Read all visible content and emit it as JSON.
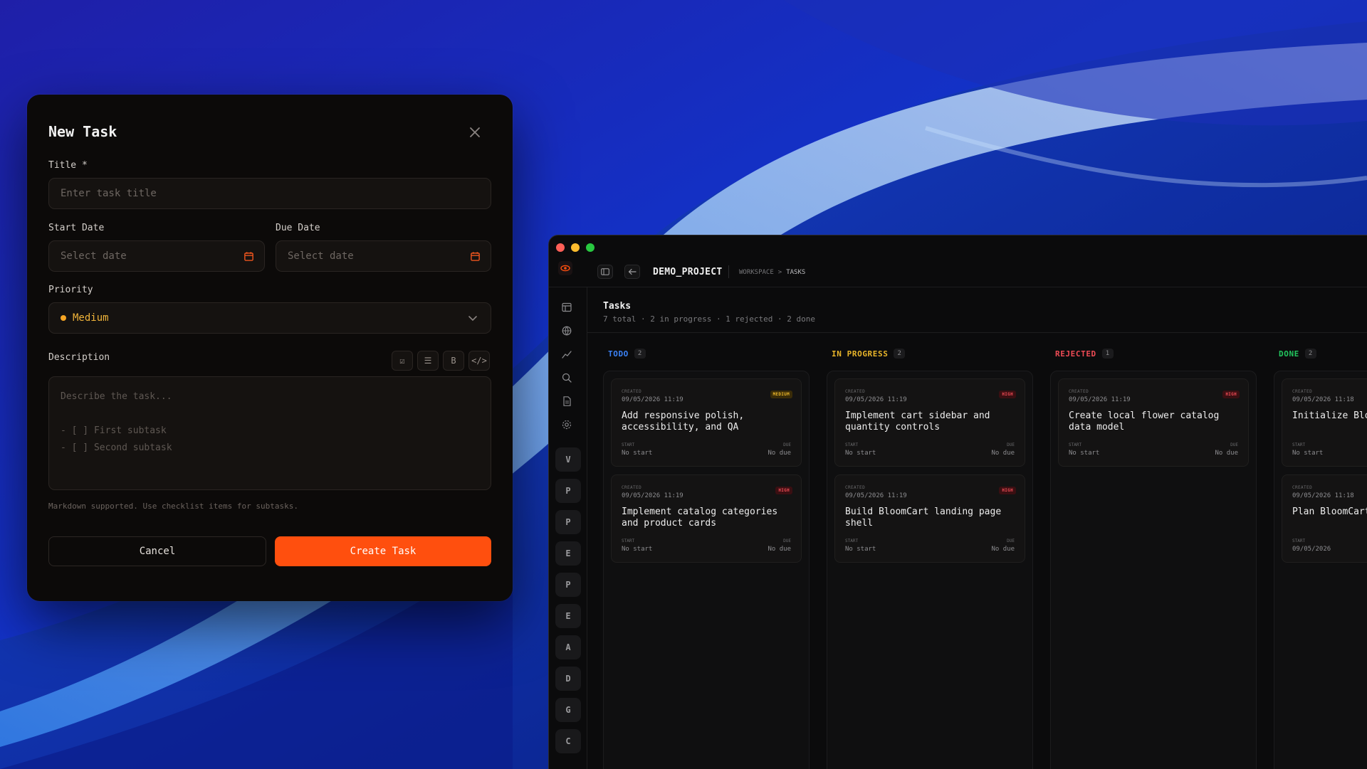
{
  "colors": {
    "accent": "#ff4f0e",
    "todo": "#3b82f6",
    "in_progress": "#e9b52a",
    "rejected": "#ef4b55",
    "done": "#22c55e",
    "priority_medium": "#f5a524"
  },
  "modal": {
    "title": "New Task",
    "close_icon": "close-icon",
    "title_label": "Title *",
    "title_placeholder": "Enter task title",
    "start_date_label": "Start Date",
    "start_date_placeholder": "Select date",
    "due_date_label": "Due Date",
    "due_date_placeholder": "Select date",
    "priority_label": "Priority",
    "priority_value": "Medium",
    "description_label": "Description",
    "format_buttons": [
      {
        "icon": "checklist-icon",
        "label": "☑"
      },
      {
        "icon": "list-icon",
        "label": "☰"
      },
      {
        "icon": "bold-icon",
        "label": "B"
      },
      {
        "icon": "code-icon",
        "label": "</>"
      }
    ],
    "description_placeholder_lines": [
      "Describe the task...",
      "",
      "- [ ] First subtask",
      "- [ ] Second subtask"
    ],
    "hint": "Markdown supported. Use checklist items for subtasks.",
    "cancel_label": "Cancel",
    "create_label": "Create Task"
  },
  "app": {
    "project_name": "DEMO_PROJECT",
    "breadcrumb": [
      "WORKSPACE",
      ">",
      "TASKS"
    ],
    "tasks_title": "Tasks",
    "tasks_summary": "7 total · 2 in progress · 1 rejected · 2 done",
    "rail_icons": [
      "layout-icon",
      "globe-icon",
      "chart-line-icon",
      "search-icon",
      "document-icon",
      "settings-icon"
    ],
    "rail_avatars": [
      "V",
      "P",
      "P",
      "E",
      "P",
      "E",
      "A",
      "D",
      "G",
      "C"
    ],
    "columns": [
      {
        "name": "TODO",
        "count": "2",
        "color_key": "todo",
        "cards": [
          {
            "created_label": "CREATED",
            "created": "09/05/2026 11:19",
            "badge": "MEDIUM",
            "badge_type": "medium",
            "title": "Add responsive polish, accessibility, and QA",
            "start_label": "START",
            "start": "No start",
            "due_label": "DUE",
            "due": "No due"
          },
          {
            "created_label": "CREATED",
            "created": "09/05/2026 11:19",
            "badge": "HIGH",
            "badge_type": "high",
            "title": "Implement catalog categories and product cards",
            "start_label": "START",
            "start": "No start",
            "due_label": "DUE",
            "due": "No due"
          }
        ]
      },
      {
        "name": "IN PROGRESS",
        "count": "2",
        "color_key": "in_progress",
        "cards": [
          {
            "created_label": "CREATED",
            "created": "09/05/2026 11:19",
            "badge": "HIGH",
            "badge_type": "high",
            "title": "Implement cart sidebar and quantity controls",
            "start_label": "START",
            "start": "No start",
            "due_label": "DUE",
            "due": "No due"
          },
          {
            "created_label": "CREATED",
            "created": "09/05/2026 11:19",
            "badge": "HIGH",
            "badge_type": "high",
            "title": "Build BloomCart landing page shell",
            "start_label": "START",
            "start": "No start",
            "due_label": "DUE",
            "due": "No due"
          }
        ]
      },
      {
        "name": "REJECTED",
        "count": "1",
        "color_key": "rejected",
        "cards": [
          {
            "created_label": "CREATED",
            "created": "09/05/2026 11:19",
            "badge": "HIGH",
            "badge_type": "high",
            "title": "Create local flower catalog data model",
            "start_label": "START",
            "start": "No start",
            "due_label": "DUE",
            "due": "No due"
          }
        ]
      },
      {
        "name": "DONE",
        "count": "2",
        "color_key": "done",
        "cards": [
          {
            "created_label": "CREATED",
            "created": "09/05/2026 11:18",
            "badge": "",
            "badge_type": "",
            "title": "Initialize BloomCart scaffold",
            "start_label": "START",
            "start": "No start",
            "due_label": "",
            "due": ""
          },
          {
            "created_label": "CREATED",
            "created": "09/05/2026 11:18",
            "badge": "",
            "badge_type": "",
            "title": "Plan BloomCart",
            "start_label": "START",
            "start": "09/05/2026",
            "due_label": "",
            "due": ""
          }
        ]
      }
    ]
  }
}
